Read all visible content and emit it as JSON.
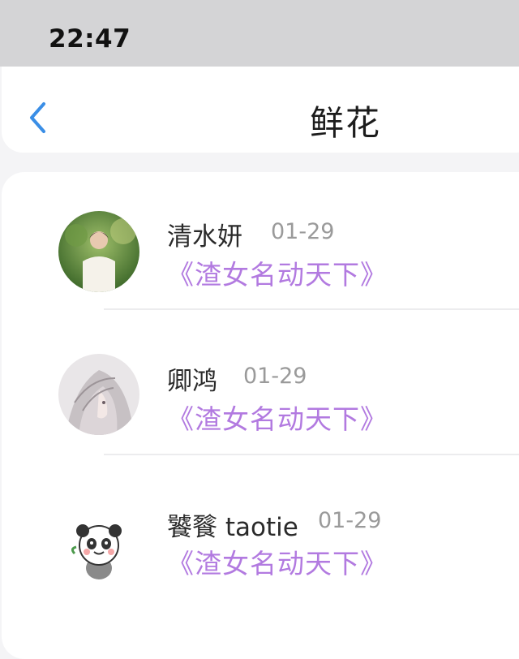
{
  "status_bar": {
    "time": "22:47"
  },
  "header": {
    "title": "鲜花",
    "back_icon": "chevron-left-icon",
    "accent": "#3a8ee6"
  },
  "list": {
    "book_color": "#b27ae0",
    "items": [
      {
        "name": "清水妍",
        "date": "01-29",
        "book": "《渣女名动天下》",
        "avatar": "photo-avatar"
      },
      {
        "name": "卿鸿",
        "date": "01-29",
        "book": "《渣女名动天下》",
        "avatar": "anime-avatar"
      },
      {
        "name": "饕餮 taotie",
        "date": "01-29",
        "book": "《渣女名动天下》",
        "avatar": "panda-avatar"
      }
    ]
  }
}
